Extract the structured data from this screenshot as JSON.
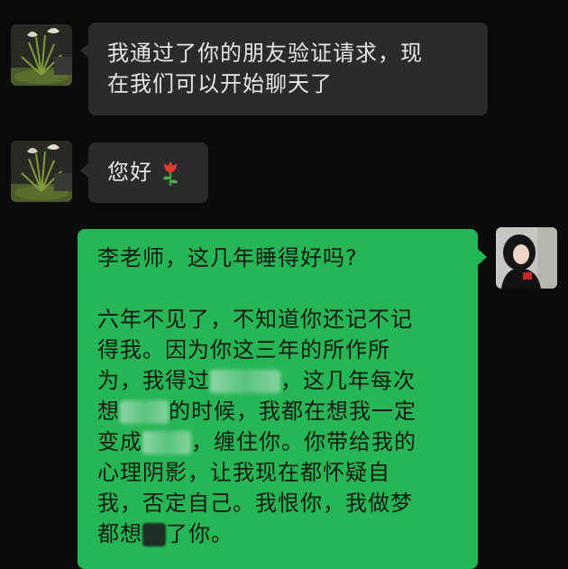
{
  "messages": [
    {
      "side": "left",
      "lines": [
        "我通过了你的朋友验证请求，现",
        "在我们可以开始聊天了"
      ]
    },
    {
      "side": "left",
      "text": "您好",
      "emoji": "rose-emoji"
    },
    {
      "side": "right",
      "p1": "李老师，这几年睡得好吗?",
      "l1": "六年不见了，不知道你还记不记",
      "l2": "得我。因为你这三年的所作所",
      "l3a": "为，我得过",
      "l3b": "，这几年每次",
      "l4a": "想",
      "l4b": "的时候，我都在想我一定",
      "l5a": "变成",
      "l5b": "，缠住你。你带给我的",
      "l6": "心理阴影，让我现在都怀疑自",
      "l7": "我，否定自己。我恨你，我做梦",
      "l8a": "都想",
      "l8b": "了你。"
    }
  ],
  "colors": {
    "background": "#0b0b0b",
    "left_bubble": "#2b2b2b",
    "right_bubble": "#27b655"
  }
}
